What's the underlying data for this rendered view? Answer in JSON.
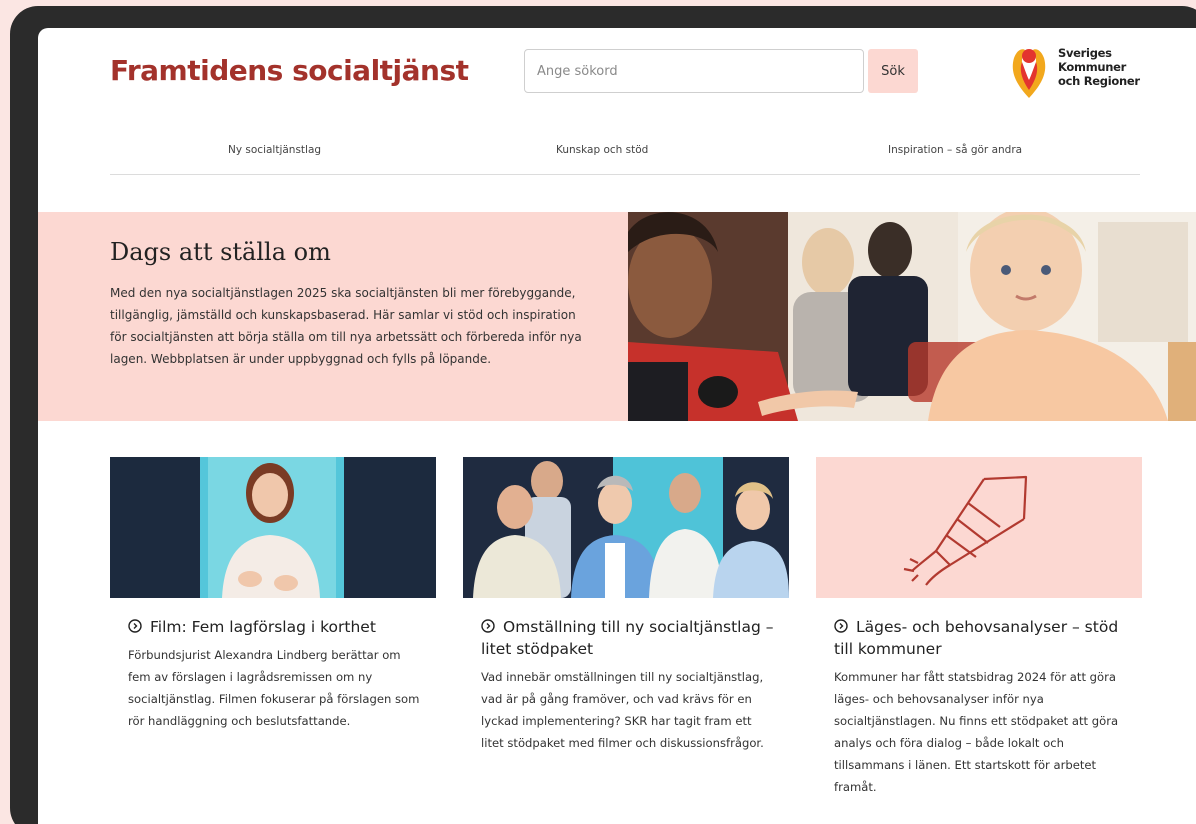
{
  "header": {
    "site_title": "Framtidens socialtjänst",
    "search_placeholder": "Ange sökord",
    "search_button": "Sök",
    "logo_lines": [
      "Sveriges",
      "Kommuner",
      "och Regioner"
    ]
  },
  "nav": {
    "items": [
      "Ny socialtjänstlag",
      "Kunskap och stöd",
      "Inspiration – så gör andra"
    ]
  },
  "hero": {
    "title": "Dags att ställa om",
    "body": "Med den nya socialtjänstlagen 2025 ska socialtjänsten bli mer förebyggande, tillgänglig, jämställd och kunskapsbaserad. Här samlar vi stöd och inspiration för socialtjänsten att börja ställa om till nya arbetssätt och förbereda inför nya lagen. Webbplatsen är under uppbyggnad och fylls på löpande."
  },
  "cards": [
    {
      "title": "Film: Fem lagförslag i korthet",
      "body": "Förbundsjurist Alexandra Lindberg berättar om fem av förslagen i lagrådsremissen om ny socialtjänstlag. Filmen fokuserar på förslagen som rör handläggning och beslutsfattande."
    },
    {
      "title": "Omställning till ny socialtjänstlag – litet stödpaket",
      "body": "Vad innebär omställningen till ny socialtjänstlag, vad är på gång framöver, och vad krävs för en lyckad implementering? SKR har tagit fram ett litet stödpaket med filmer och diskussionsfrågor."
    },
    {
      "title": "Läges- och behovsanalyser – stöd till kommuner",
      "body": "Kommuner har fått statsbidrag 2024 för att göra läges- och behovsanalyser inför nya socialtjänstlagen. Nu finns ett stödpaket att göra analys och föra dialog – både lokalt och tillsammans i länen. Ett startskott för arbetet framåt."
    }
  ],
  "colors": {
    "brand_red": "#a3322b",
    "pink_bg": "#fcd8d2",
    "frame": "#2b2b2b"
  },
  "icons": {
    "card_link": "circle-chevron-right-icon",
    "rocket": "firework-rocket-icon",
    "logo": "skr-logo-icon"
  }
}
